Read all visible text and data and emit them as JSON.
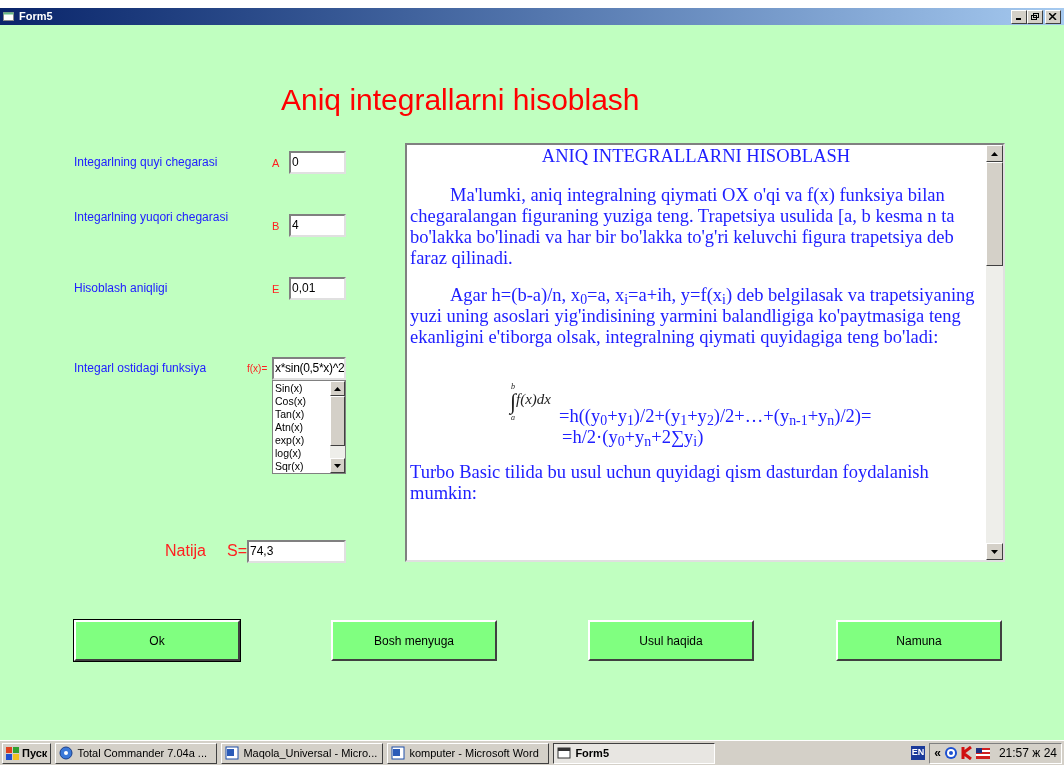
{
  "window": {
    "title": "Form5"
  },
  "heading": "Aniq integrallarni hisoblash",
  "inputs": [
    {
      "label": "Integarlning quyi chegarasi",
      "letter": "A",
      "value": "0"
    },
    {
      "label": "Integarlning yuqori chegarasi",
      "letter": "B",
      "value": "4"
    },
    {
      "label": "Hisoblash aniqligi",
      "letter": "E",
      "value": "0,01"
    }
  ],
  "function": {
    "label": "Integarl ostidagi funksiya",
    "letter": "f(x)=",
    "value": "x*sin(0,5*x)^2",
    "list": [
      {
        "text": "Sin(x)",
        "selected": false
      },
      {
        "text": "Cos(x)",
        "selected": false
      },
      {
        "text": "Tan(x)",
        "selected": false
      },
      {
        "text": "Atn(x)",
        "selected": false
      },
      {
        "text": "exp(x)",
        "selected": false
      },
      {
        "text": "log(x)",
        "selected": false
      },
      {
        "text": "Sqr(x)",
        "selected": false
      }
    ]
  },
  "result": {
    "label": "Natija",
    "letter": "S=",
    "value": "74,3"
  },
  "article": [
    {
      "kind": "heading",
      "text": "ANIQ INTEGRALLARNI HISOBLASH"
    },
    {
      "kind": "paragraph",
      "indent": true,
      "text": "Ma'lumki, aniq integralning qiymati OX o'qi va f(x) funksiya bilan chegaralangan figuraning yuziga teng. Trapetsiya usulida [a, b kesma n ta bo'lakka bo'linadi va har bir bo'lakka to'g'ri keluvchi figura trapetsiya deb faraz qilinadi."
    },
    {
      "kind": "paragraph",
      "indent": true,
      "text": "Agar h=(b-a)/n, x$_{0}$=a, x$_{i}$=a+ih, y=f(x$_{i}$) deb belgilasak va trapetsiyaning yuzi uning asoslari yig'indisining yarmini balandligiga ko'paytmasiga teng ekanligini e'tiborga olsak, integralning qiymati quyidagiga teng bo'ladi:"
    },
    {
      "kind": "formula",
      "upper": "b",
      "lower": "a",
      "sign": "∫",
      "integrand": "f(x)dx",
      "lines": [
        "=h((y$_{0}$+y$_{1}$)/2+(y$_{1}$+y$_{2}$)/2+…+(y$_{n-1}$+y$_{n}$)/2)=",
        "=h/2·(y$_{0}$+y$_{n}$+2∑y$_{i}$)"
      ]
    },
    {
      "kind": "paragraph",
      "indent": false,
      "text": "Turbo Basic tilida bu usul uchun quyidagi qism dasturdan foydalanish mumkin:"
    }
  ],
  "buttons": [
    "Ok",
    "Bosh menyuga",
    "Usul haqida",
    "Namuna"
  ],
  "taskbar": {
    "start": "Пуск",
    "tasks": [
      {
        "kind": "commander",
        "label": "Total Commander 7.04a ...",
        "selected": false
      },
      {
        "kind": "word",
        "label": "Maqola_Universal - Micro...",
        "selected": false
      },
      {
        "kind": "word",
        "label": "komputer - Microsoft Word",
        "selected": false
      },
      {
        "kind": "form",
        "label": "Form5",
        "selected": true
      }
    ],
    "language": "EN",
    "chevron": "«",
    "clock": "21:57 ж 24"
  }
}
